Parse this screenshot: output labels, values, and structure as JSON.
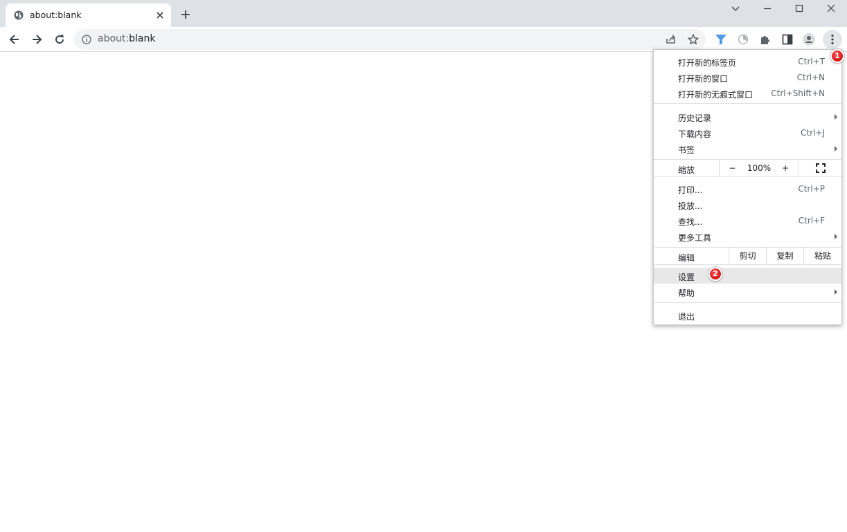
{
  "tab": {
    "title": "about:blank",
    "favicon": "globe-icon"
  },
  "toolbar": {
    "url_prefix": "about:",
    "url_host": "blank"
  },
  "menu": {
    "items": [
      {
        "label": "打开新的标签页",
        "shortcut": "Ctrl+T"
      },
      {
        "label": "打开新的窗口",
        "shortcut": "Ctrl+N"
      },
      {
        "label": "打开新的无痕式窗口",
        "shortcut": "Ctrl+Shift+N"
      },
      {
        "label": "历史记录",
        "shortcut": ""
      },
      {
        "label": "下载内容",
        "shortcut": "Ctrl+J"
      },
      {
        "label": "书签",
        "shortcut": ""
      },
      {
        "label": "打印...",
        "shortcut": "Ctrl+P"
      },
      {
        "label": "投放...",
        "shortcut": ""
      },
      {
        "label": "查找...",
        "shortcut": "Ctrl+F"
      },
      {
        "label": "更多工具",
        "shortcut": ""
      },
      {
        "label": "设置",
        "shortcut": ""
      },
      {
        "label": "帮助",
        "shortcut": ""
      },
      {
        "label": "退出",
        "shortcut": ""
      }
    ],
    "zoom": {
      "label": "缩放",
      "minus": "−",
      "value": "100%",
      "plus": "+"
    },
    "edit": {
      "label": "编辑",
      "cut": "剪切",
      "copy": "复制",
      "paste": "粘贴"
    }
  },
  "annotations": {
    "badge1": "1",
    "badge2": "2"
  },
  "colors": {
    "badge": "#d50000",
    "tabstrip": "#dee1e6",
    "highlight": "#e8e8e8"
  }
}
